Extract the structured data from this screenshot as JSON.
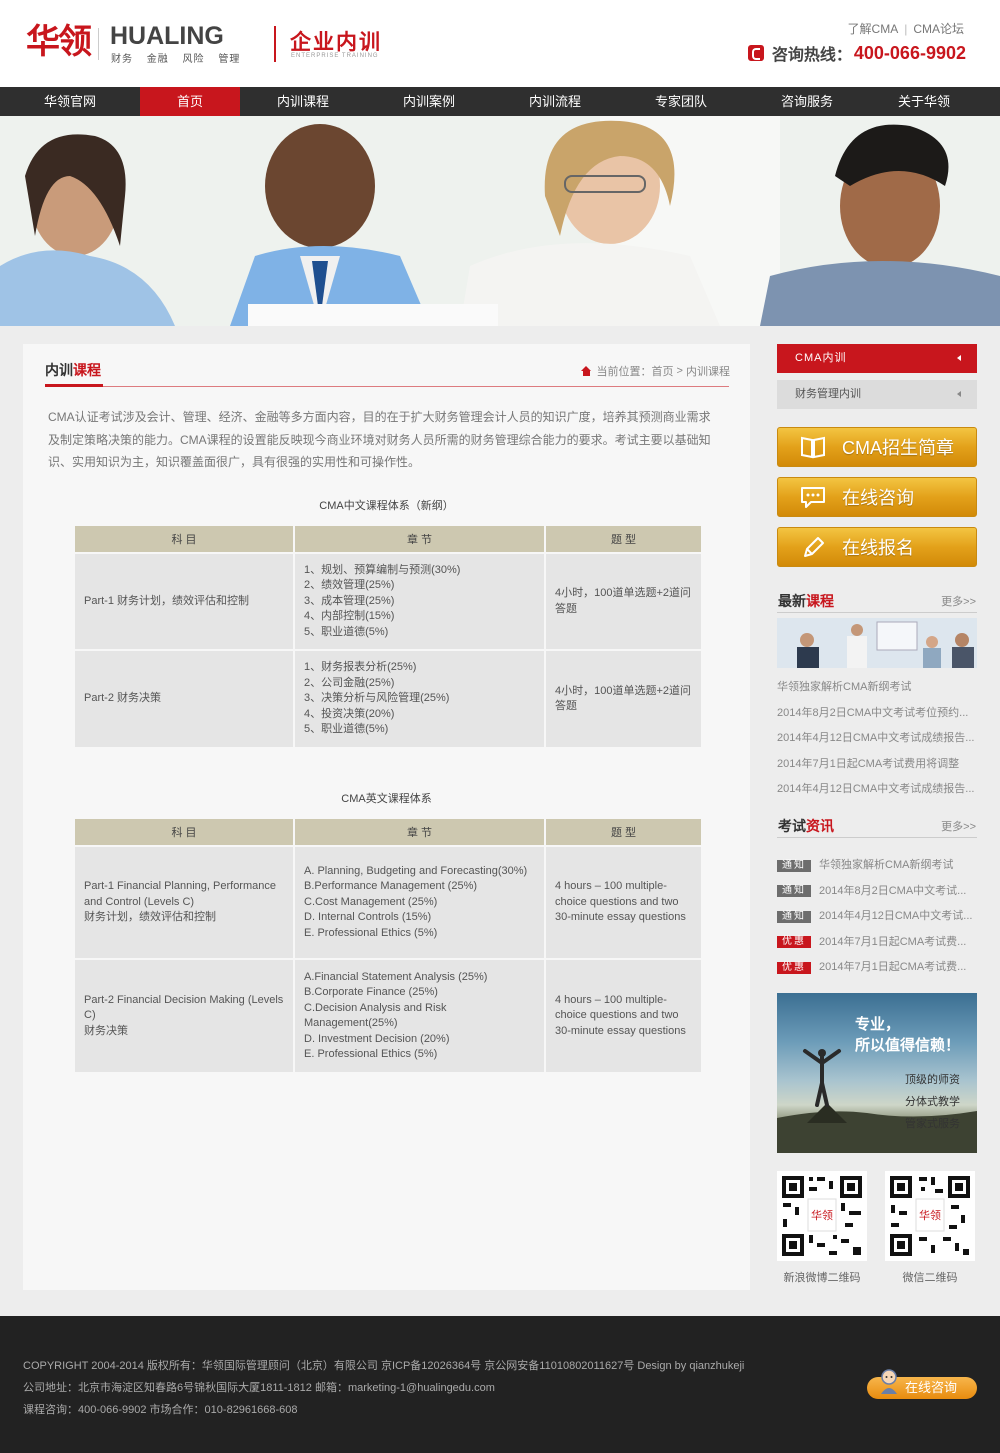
{
  "header": {
    "logo_cn": "华领",
    "logo_en": "HUALING",
    "logo_sub": "财务 金融 风险 管理",
    "brand_title": "企业内训",
    "brand_sub": "ENTERPRISE TRAINING",
    "toplinks": [
      "了解CMA",
      "CMA论坛"
    ],
    "hotline_label": "咨询热线：",
    "hotline_number": "400-066-9902"
  },
  "nav": {
    "items": [
      {
        "label": "华领官网",
        "active": false
      },
      {
        "label": "首页",
        "active": true
      },
      {
        "label": "内训课程",
        "active": false
      },
      {
        "label": "内训案例",
        "active": false
      },
      {
        "label": "内训流程",
        "active": false
      },
      {
        "label": "专家团队",
        "active": false
      },
      {
        "label": "咨询服务",
        "active": false
      },
      {
        "label": "关于华领",
        "active": false
      }
    ]
  },
  "main": {
    "title_black": "内训",
    "title_red": "课程",
    "breadcrumb": {
      "prefix": "当前位置：",
      "home": "首页",
      "sep": " > ",
      "current": "内训课程"
    },
    "intro": "CMA认证考试涉及会计、管理、经济、金融等多方面内容，目的在于扩大财务管理会计人员的知识广度，培养其预测商业需求及制定策略决策的能力。CMA课程的设置能反映现今商业环境对财务人员所需的财务管理综合能力的要求。考试主要以基础知识、实用知识为主，知识覆盖面很广，具有很强的实用性和可操作性。",
    "table_cn": {
      "caption": "CMA中文课程体系（新纲）",
      "headers": [
        "科 目",
        "章 节",
        "题 型"
      ],
      "rows": [
        {
          "subject": "Part-1 财务计划，绩效评估和控制",
          "chapters": [
            "1、规划、预算编制与预测(30%)",
            "2、绩效管理(25%)",
            "3、成本管理(25%)",
            "4、内部控制(15%)",
            "5、职业道德(5%)"
          ],
          "type": "4小时，100道单选题+2道问答题"
        },
        {
          "subject": "Part-2 财务决策",
          "chapters": [
            "1、财务报表分析(25%)",
            "2、公司金融(25%)",
            "3、决策分析与风险管理(25%)",
            "4、投资决策(20%)",
            "5、职业道德(5%)"
          ],
          "type": "4小时，100道单选题+2道问答题"
        }
      ]
    },
    "table_en": {
      "caption": "CMA英文课程体系",
      "headers": [
        "科 目",
        "章 节",
        "题 型"
      ],
      "rows": [
        {
          "subject": [
            "Part-1 Financial Planning, Performance and Control (Levels C)",
            "财务计划，绩效评估和控制"
          ],
          "chapters": [
            "A. Planning, Budgeting and Forecasting(30%)",
            "B.Performance Management (25%)",
            "C.Cost Management (25%)",
            "D. Internal Controls (15%)",
            "E. Professional Ethics (5%)"
          ],
          "type": "4 hours – 100 multiple-choice questions and two 30-minute essay questions"
        },
        {
          "subject": [
            "Part-2 Financial Decision Making (Levels C)",
            "财务决策"
          ],
          "chapters": [
            "A.Financial Statement Analysis (25%)",
            "B.Corporate Finance (25%)",
            "C.Decision Analysis and Risk Management(25%)",
            "D. Investment Decision (20%)",
            "E. Professional Ethics (5%)"
          ],
          "type": "4 hours – 100 multiple-choice questions and two 30-minute essay questions"
        }
      ]
    }
  },
  "sidebar": {
    "menu": [
      {
        "label": "CMA内训",
        "active": true
      },
      {
        "label": "财务管理内训",
        "active": false
      }
    ],
    "buttons": [
      "CMA招生简章",
      "在线咨询",
      "在线报名"
    ],
    "latest": {
      "title_black": "最新",
      "title_red": "课程",
      "more": "更多>>",
      "items": [
        "华领独家解析CMA新纲考试",
        "2014年8月2日CMA中文考试考位预约...",
        "2014年4月12日CMA中文考试成绩报告...",
        "2014年7月1日起CMA考试费用将调整",
        "2014年4月12日CMA中文考试成绩报告..."
      ]
    },
    "news": {
      "title_black": "考试",
      "title_red": "资讯",
      "more": "更多>>",
      "items": [
        {
          "tag": "通知",
          "kind": "notice",
          "text": "华领独家解析CMA新纲考试"
        },
        {
          "tag": "通知",
          "kind": "notice",
          "text": "2014年8月2日CMA中文考试..."
        },
        {
          "tag": "通知",
          "kind": "notice",
          "text": "2014年4月12日CMA中文考试..."
        },
        {
          "tag": "优惠",
          "kind": "promo",
          "text": "2014年7月1日起CMA考试费..."
        },
        {
          "tag": "优惠",
          "kind": "promo",
          "text": "2014年7月1日起CMA考试费..."
        }
      ]
    },
    "ad": {
      "line1": "专业，",
      "line2": "所以值得信赖！",
      "points": [
        "顶级的师资",
        "分体式教学",
        "管家式服务"
      ]
    },
    "qr": [
      {
        "label": "新浪微博二维码",
        "mark": "华领"
      },
      {
        "label": "微信二维码",
        "mark": "华领"
      }
    ]
  },
  "footer": {
    "line1": "COPYRIGHT  2004-2014 版权所有：华领国际管理顾问（北京）有限公司 京ICP备12026364号 京公网安备11010802011627号     Design by qianzhukeji",
    "line2": "公司地址：北京市海淀区知春路6号锦秋国际大厦1811-1812     邮箱：marketing-1@hualingedu.com",
    "line3": "课程咨询：400-066-9902     市场合作：010-82961668-608",
    "chat_label": "在线咨询"
  }
}
